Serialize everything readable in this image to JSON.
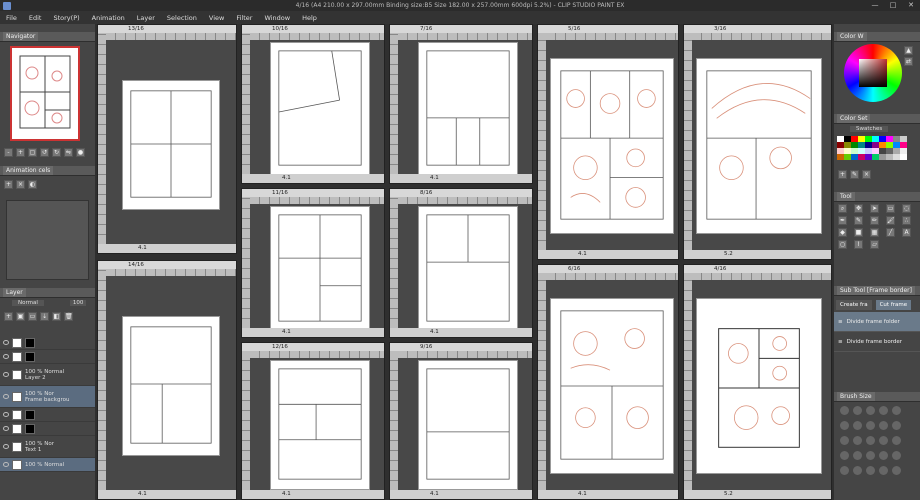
{
  "window": {
    "title": "4/16 (A4 210.00 x 297.00mm Binding size:B5 Size 182.00 x 257.00mm 600dpi 5.2%) - CLIP STUDIO PAINT EX",
    "controls": [
      "—",
      "□",
      "✕"
    ]
  },
  "menu": [
    "File",
    "Edit",
    "Story(P)",
    "Animation",
    "Layer",
    "Selection",
    "View",
    "Filter",
    "Window",
    "Help"
  ],
  "left_panel": {
    "navigator_tab": "Navigator",
    "animation_tab": "Animation cels",
    "layer_tab": "Layer",
    "blend_mode": "Normal",
    "opacity": "100",
    "layers": [
      {
        "name": "",
        "mode": ""
      },
      {
        "name": "",
        "mode": ""
      },
      {
        "name": "100 % Normal",
        "mode": "Layer 2"
      },
      {
        "name": "100 % Nor",
        "mode": "Frame backgrou"
      },
      {
        "name": "",
        "mode": ""
      },
      {
        "name": "",
        "mode": ""
      },
      {
        "name": "100 % Nor",
        "mode": "Text 1"
      },
      {
        "name": "100 % Normal",
        "mode": ""
      }
    ]
  },
  "right_panel": {
    "color_tab": "Color W",
    "colorset_tab": "Color Set",
    "swatches_label": "Swatches",
    "tool_tab": "Tool",
    "subtool_tab": "Sub Tool [Frame border]",
    "create_frame_btn": "Create fra",
    "cut_frame_btn": "Cut frame",
    "subtools": [
      "Divide frame folder",
      "Divide frame border"
    ],
    "brush_tab": "Brush Size",
    "accent": "#6a8fd0"
  },
  "pages": [
    {
      "label": "13/16",
      "status": "4.1"
    },
    {
      "label": "14/16",
      "status": "4.1"
    },
    {
      "label": "10/16",
      "status": "4.1"
    },
    {
      "label": "11/16",
      "status": "4.1"
    },
    {
      "label": "12/16",
      "status": "4.1"
    },
    {
      "label": "7/16",
      "status": "4.1"
    },
    {
      "label": "8/16",
      "status": "4.1"
    },
    {
      "label": "9/16",
      "status": "4.1"
    },
    {
      "label": "5/16",
      "status": "4.1"
    },
    {
      "label": "6/16",
      "status": "4.1"
    },
    {
      "label": "3/16",
      "status": "5.2"
    },
    {
      "label": "4/16",
      "status": "5.2"
    }
  ]
}
